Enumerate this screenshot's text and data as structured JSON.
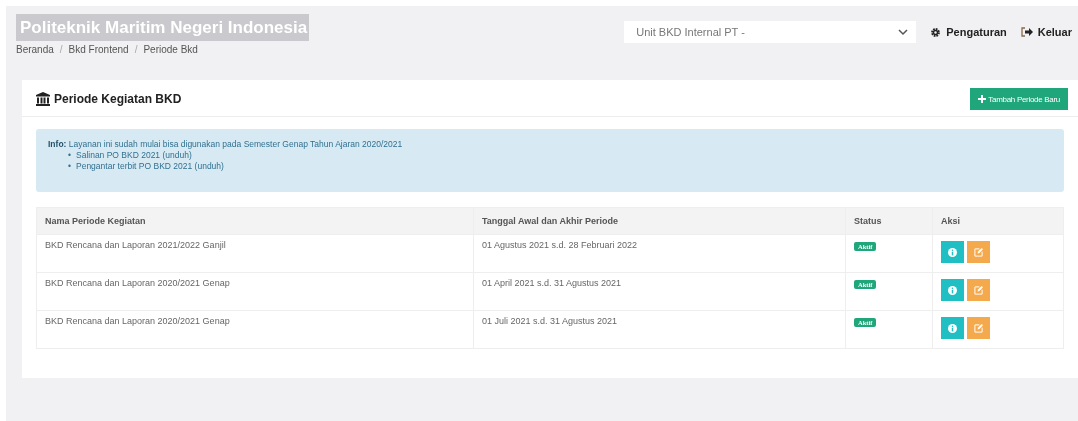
{
  "header": {
    "title": "Politeknik Maritim Negeri Indonesia",
    "unit_select": {
      "value": "Unit BKD Internal PT -"
    },
    "nav": [
      {
        "kind": "settings",
        "label": "Pengaturan"
      },
      {
        "kind": "logout",
        "label": "Keluar"
      }
    ]
  },
  "breadcrumb": {
    "separator": "/",
    "items": [
      "Beranda",
      "Bkd Frontend",
      "Periode Bkd"
    ]
  },
  "card": {
    "title": "Periode Kegiatan BKD",
    "add_button": "Tambah Periode Baru",
    "info": {
      "label": "Info:",
      "text": "Layanan ini sudah mulai bisa digunakan pada Semester Genap Tahun Ajaran 2020/2021",
      "items": [
        {
          "bullet": "•",
          "text": "Salinan PO BKD 2021",
          "link": "(unduh)"
        },
        {
          "bullet": "•",
          "text": "Pengantar terbit PO BKD 2021",
          "link": "(unduh)"
        }
      ]
    },
    "table": {
      "columns": [
        "Nama Periode Kegiatan",
        "Tanggal Awal dan Akhir Periode",
        "Status",
        "Aksi"
      ],
      "rows": [
        {
          "name": "BKD Rencana dan Laporan 2021/2022 Ganjil",
          "period": "01 Agustus 2021 s.d. 28 Februari 2022",
          "status": "Aktif"
        },
        {
          "name": "BKD Rencana dan Laporan 2020/2021 Genap",
          "period": "01 April 2021 s.d. 31 Agustus 2021",
          "status": "Aktif"
        },
        {
          "name": "BKD Rencana dan Laporan 2020/2021 Genap",
          "period": "01 Juli 2021 s.d. 31 Agustus 2021",
          "status": "Aktif"
        }
      ]
    }
  }
}
